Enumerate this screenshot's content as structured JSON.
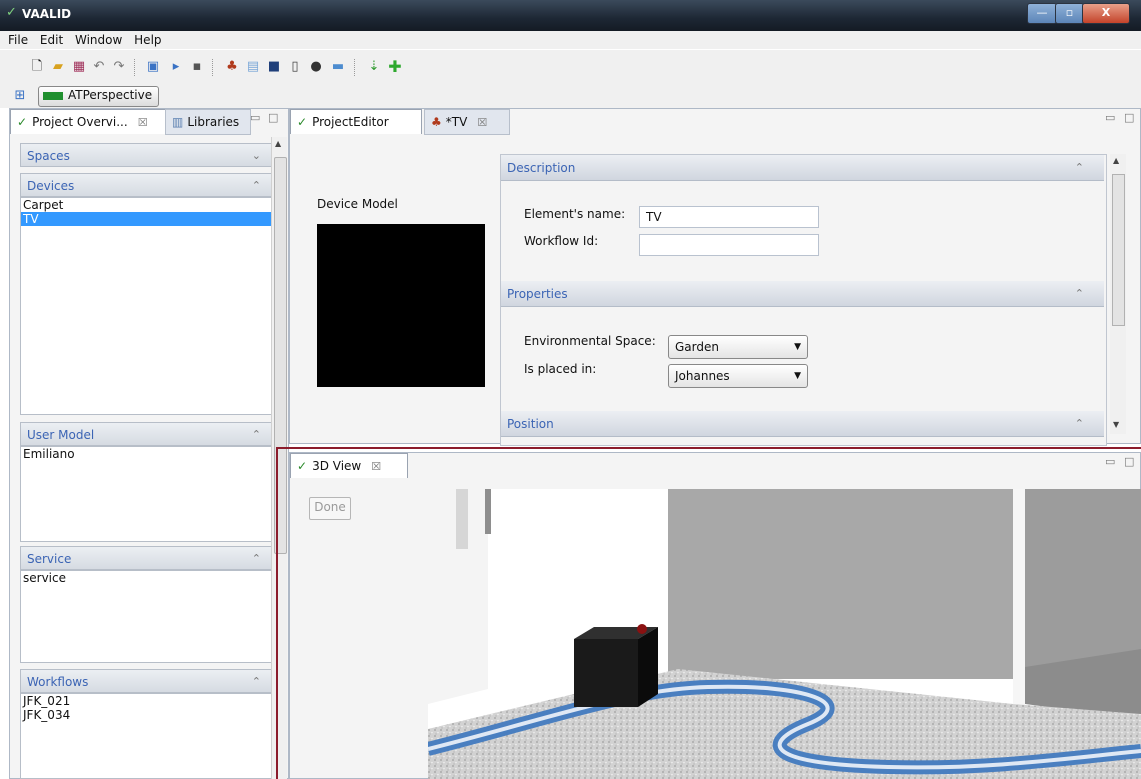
{
  "window": {
    "title": "VAALID",
    "minimize": "—",
    "maximize": "▫",
    "close": "X"
  },
  "menu": [
    "File",
    "Edit",
    "Window",
    "Help"
  ],
  "perspective": {
    "label": "ATPerspective"
  },
  "left_tabs": [
    {
      "label": "Project Overvi...",
      "close": "☒"
    },
    {
      "label": "Libraries"
    }
  ],
  "sections": {
    "spaces": {
      "title": "Spaces",
      "items": []
    },
    "devices": {
      "title": "Devices",
      "items": [
        "Carpet",
        "TV"
      ],
      "selected": "TV"
    },
    "user_model": {
      "title": "User Model",
      "items": [
        "Emiliano"
      ]
    },
    "service": {
      "title": "Service",
      "items": [
        "service"
      ]
    },
    "workflows": {
      "title": "Workflows",
      "items": [
        "JFK_021",
        "JFK_034"
      ]
    }
  },
  "editor_tabs": [
    {
      "label": "ProjectEditor"
    },
    {
      "label": "*TV",
      "close": "☒"
    }
  ],
  "device_model_label": "Device Model",
  "description": {
    "title": "Description",
    "name_label": "Element's name:",
    "name_value": "TV",
    "workflow_label": "Workflow Id:",
    "workflow_value": ""
  },
  "properties": {
    "title": "Properties",
    "env_label": "Environmental Space:",
    "env_value": "Garden",
    "placed_label": "Is placed in:",
    "placed_value": "Johannes"
  },
  "position": {
    "title": "Position"
  },
  "view3d": {
    "tab_label": "3D View",
    "close": "☒",
    "done_label": "Done"
  },
  "colors": {
    "accent": "#3b64b4",
    "selection": "#3399ff",
    "divider": "#8c1c2c"
  }
}
